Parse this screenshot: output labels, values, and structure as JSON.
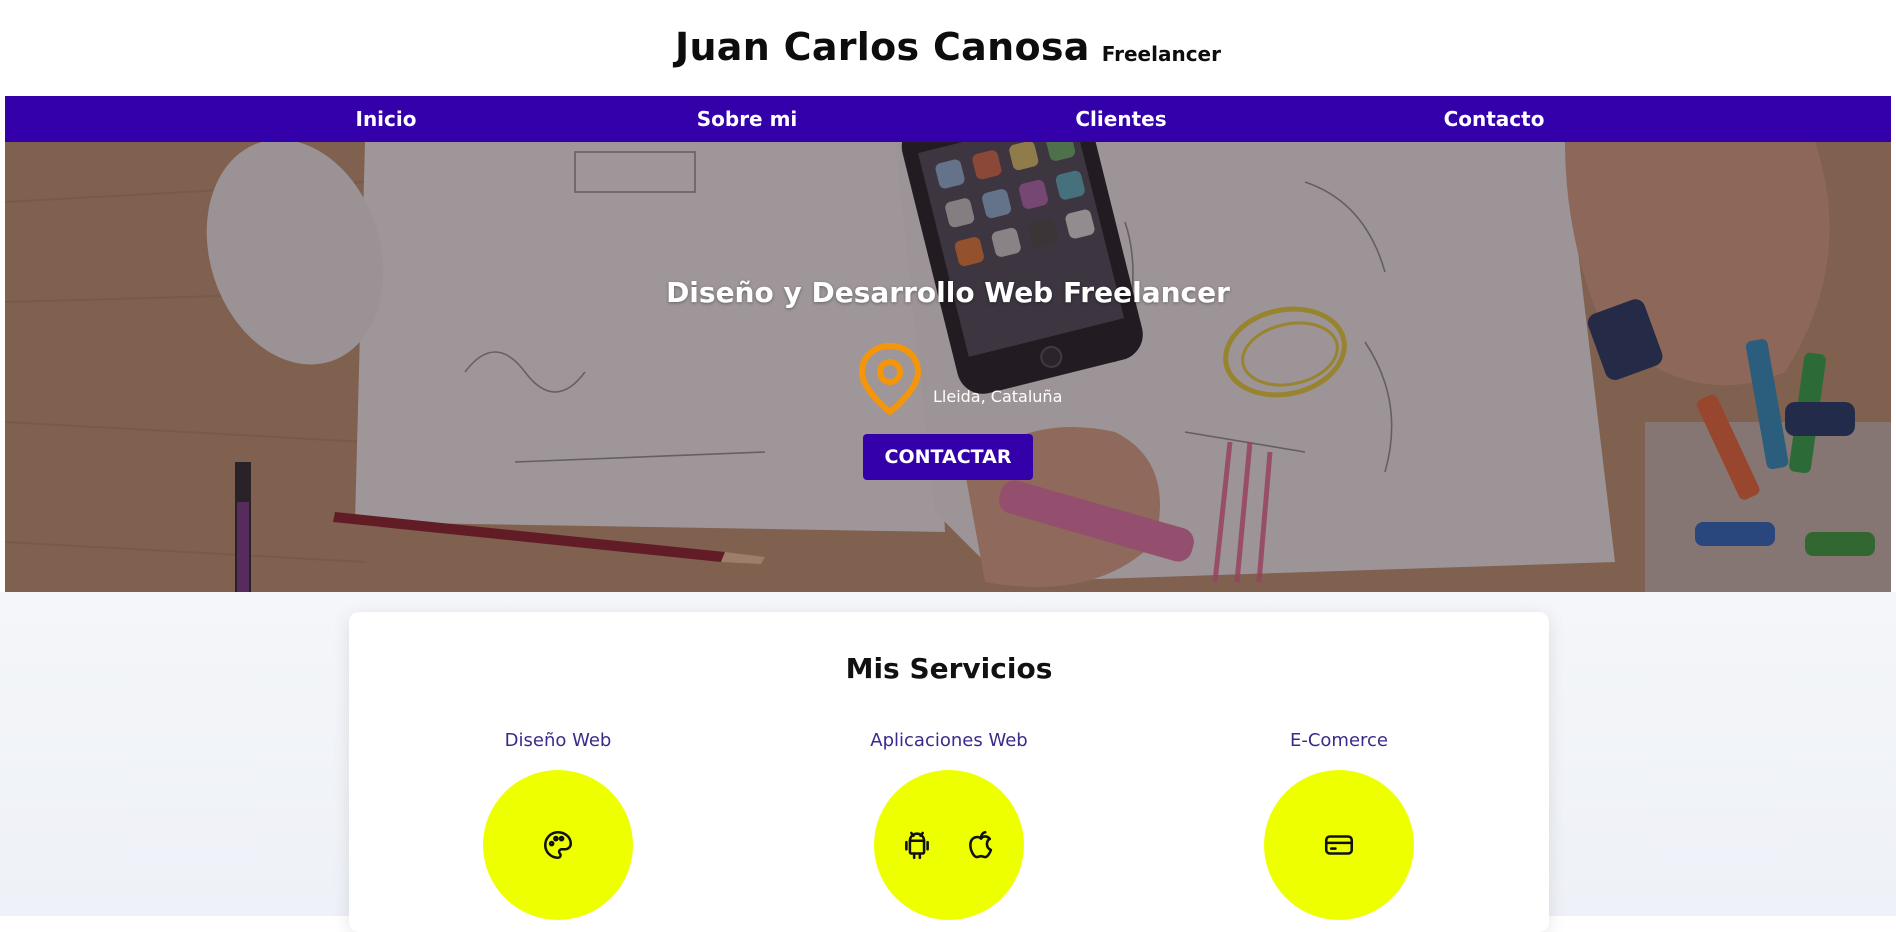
{
  "header": {
    "title": "Juan Carlos Canosa",
    "subtitle": "Freelancer"
  },
  "nav": {
    "items": [
      {
        "label": "Inicio"
      },
      {
        "label": "Sobre mi"
      },
      {
        "label": "Clientes"
      },
      {
        "label": "Contacto"
      }
    ]
  },
  "hero": {
    "title": "Diseño y Desarrollo Web Freelancer",
    "location": "Lleida, Cataluña",
    "location_icon": "map-pin-icon",
    "cta_label": "CONTACTAR"
  },
  "services": {
    "title": "Mis Servicios",
    "items": [
      {
        "name": "Diseño Web",
        "icons": [
          "palette-icon"
        ]
      },
      {
        "name": "Aplicaciones Web",
        "icons": [
          "android-icon",
          "apple-icon"
        ]
      },
      {
        "name": "E-Comerce",
        "icons": [
          "credit-card-icon"
        ]
      }
    ]
  },
  "colors": {
    "brand": "#3300aa",
    "accent_pin": "#f5960a",
    "service_circle": "#eeff00",
    "service_text": "#3a2a8c"
  }
}
